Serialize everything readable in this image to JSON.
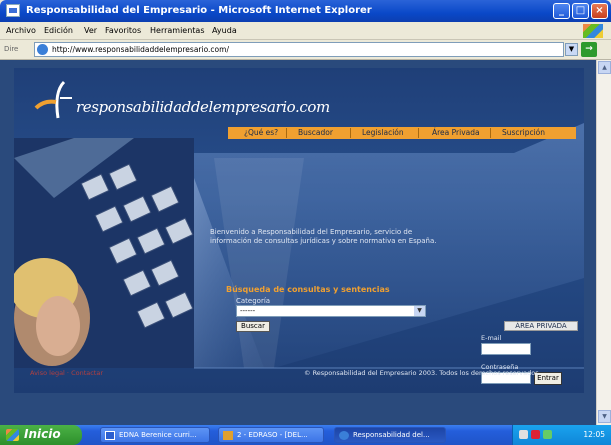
{
  "window": {
    "title": "Responsabilidad del Empresario - Microsoft Internet Explorer"
  },
  "menu": [
    "Archivo",
    "Edición",
    "Ver",
    "Favoritos",
    "Herramientas",
    "Ayuda"
  ],
  "address": {
    "label": "Dire",
    "url": "http://www.responsabilidaddelempresario.com/"
  },
  "site": {
    "logo": "responsabilidaddelempresario.com",
    "nav": [
      "¿Qué es?",
      "Buscador",
      "Legislación",
      "Área Privada",
      "Suscripción"
    ],
    "intro": "Bienvenido a Responsabilidad del Empresario, servicio de información de consultas jurídicas y sobre normativa en España.",
    "search_title": "Búsqueda de consultas y sentencias",
    "category_label": "Categoría",
    "category_value": "------",
    "search_button": "Buscar",
    "private_header": "ÁREA PRIVADA",
    "email_label": "E-mail",
    "password_label": "Contraseña",
    "enter_button": "Entrar",
    "footer_left": "Aviso legal · Contactar",
    "footer_right": "© Responsabilidad del Empresario 2003. Todos los derechos reservados."
  },
  "taskbar": {
    "start": "Inicio",
    "tasks": [
      "EDNA Berenice curri...",
      "2 - EDRASO - [DEL...",
      "Responsabilidad del..."
    ],
    "clock": "12:05"
  },
  "colors": {
    "accent": "#f0a030",
    "page_bg": "#1f3f78",
    "titlebar": "#0a48c8"
  }
}
